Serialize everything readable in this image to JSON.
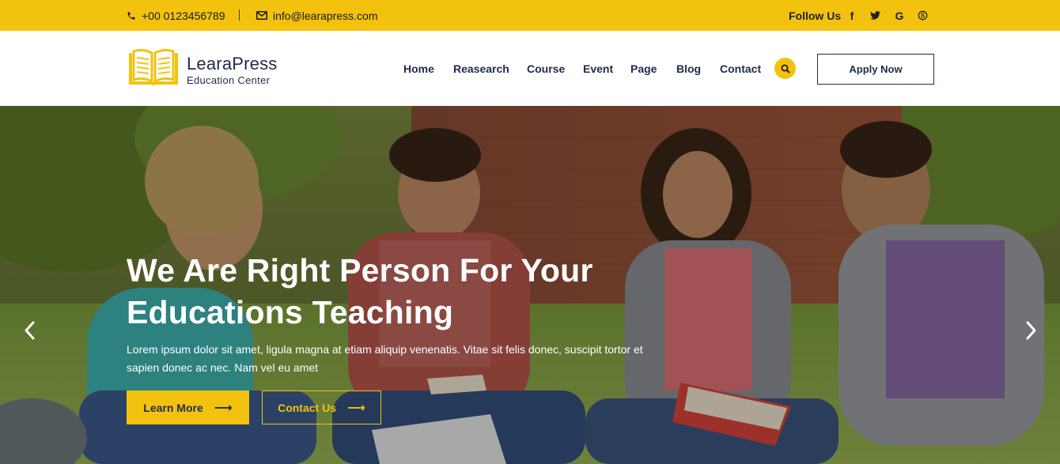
{
  "topbar": {
    "phone": "+00 0123456789",
    "email": "info@learapress.com",
    "follow_label": "Follow Us",
    "social": [
      "f",
      "t",
      "G",
      "S"
    ],
    "social_icons": [
      "facebook-icon",
      "twitter-icon",
      "google-icon",
      "skype-icon"
    ]
  },
  "brand": {
    "name": "LearaPress",
    "tagline": "Education Center",
    "accent": "#f3c20f",
    "navy": "#1f2b4a"
  },
  "nav": {
    "items": [
      "Home",
      "Reasearch",
      "Course",
      "Event",
      "Page",
      "Blog",
      "Contact"
    ],
    "apply_label": "Apply Now"
  },
  "hero": {
    "title": "We Are Right Person For Your Educations Teaching",
    "text": "Lorem ipsum dolor sit amet, ligula magna at etiam aliquip venenatis. Vitae sit felis donec, suscipit tortor et sapien donec ac nec. Nam vel eu amet",
    "learn_label": "Learn More",
    "contact_label": "Contact Us"
  }
}
